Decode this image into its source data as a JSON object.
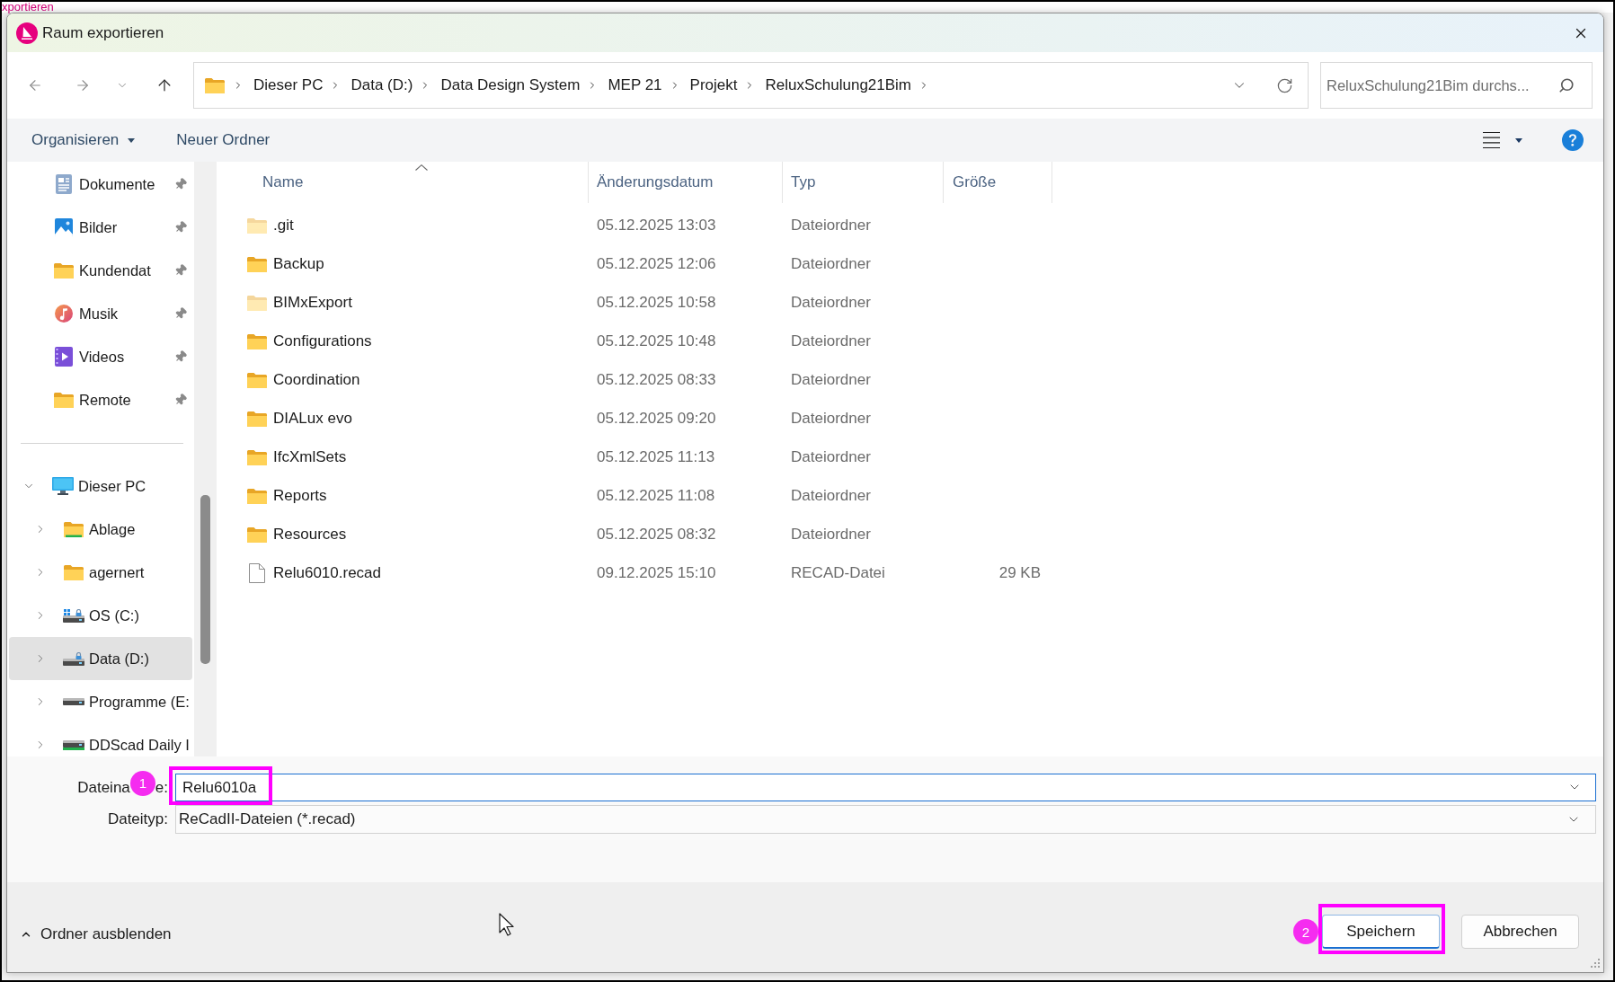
{
  "background": {
    "title_fragment": "xportieren"
  },
  "window": {
    "title": "Raum exportieren"
  },
  "address_bar": {
    "breadcrumbs": [
      "Dieser PC",
      "Data (D:)",
      "Data Design System",
      "MEP 21",
      "Projekt",
      "ReluxSchulung21Bim"
    ]
  },
  "search": {
    "placeholder": "ReluxSchulung21Bim durchs..."
  },
  "toolbar": {
    "items": [
      {
        "label": "Organisieren",
        "kind": "menu"
      },
      {
        "label": "Neuer Ordner",
        "kind": "button"
      }
    ]
  },
  "sidebar": {
    "quick_access": [
      {
        "label": "Dokumente",
        "kind": "documents",
        "pinned": true,
        "selected": false
      },
      {
        "label": "Bilder",
        "kind": "pictures",
        "pinned": true,
        "selected": false
      },
      {
        "label": "Kundendat",
        "kind": "folder",
        "pinned": true,
        "selected": false
      },
      {
        "label": "Musik",
        "kind": "music",
        "pinned": true,
        "selected": false
      },
      {
        "label": "Videos",
        "kind": "videos",
        "pinned": true,
        "selected": false
      },
      {
        "label": "Remote",
        "kind": "folder",
        "pinned": true,
        "selected": false
      }
    ],
    "tree": [
      {
        "label": "Dieser PC",
        "kind": "computer",
        "expanded": true,
        "selected": false,
        "children": [
          {
            "label": "Ablage",
            "kind": "sharedfolder",
            "expanded": false,
            "selected": false
          },
          {
            "label": "agernert",
            "kind": "folder",
            "expanded": false,
            "selected": false
          },
          {
            "label": "OS (C:)",
            "kind": "systemdrive",
            "expanded": false,
            "selected": false
          },
          {
            "label": "Data (D:)",
            "kind": "lockeddrive",
            "expanded": false,
            "selected": true
          },
          {
            "label": "Programme (E:",
            "kind": "drive",
            "expanded": false,
            "selected": false
          },
          {
            "label": "DDScad Daily I",
            "kind": "netdrive",
            "expanded": false,
            "selected": false
          }
        ]
      }
    ]
  },
  "file_list": {
    "columns": [
      {
        "label": "Name",
        "sorted": true
      },
      {
        "label": "Änderungsdatum",
        "sorted": false
      },
      {
        "label": "Typ",
        "sorted": false
      },
      {
        "label": "Größe",
        "sorted": false
      }
    ],
    "rows": [
      {
        "name": ".git",
        "modified": "05.12.2025 13:03",
        "type": "Dateiordner",
        "kind": "folder",
        "hidden": true,
        "selected": false
      },
      {
        "name": "Backup",
        "modified": "05.12.2025 12:06",
        "type": "Dateiordner",
        "kind": "folder",
        "hidden": false,
        "selected": false
      },
      {
        "name": "BIMxExport",
        "modified": "05.12.2025 10:58",
        "type": "Dateiordner",
        "kind": "folder",
        "hidden": true,
        "selected": false
      },
      {
        "name": "Configurations",
        "modified": "05.12.2025 10:48",
        "type": "Dateiordner",
        "kind": "folder",
        "hidden": false,
        "selected": false
      },
      {
        "name": "Coordination",
        "modified": "05.12.2025 08:33",
        "type": "Dateiordner",
        "kind": "folder",
        "hidden": false,
        "selected": false
      },
      {
        "name": "DIALux evo",
        "modified": "05.12.2025 09:20",
        "type": "Dateiordner",
        "kind": "folder",
        "hidden": false,
        "selected": false
      },
      {
        "name": "IfcXmlSets",
        "modified": "05.12.2025 11:13",
        "type": "Dateiordner",
        "kind": "folder",
        "hidden": false,
        "selected": false
      },
      {
        "name": "Reports",
        "modified": "05.12.2025 11:08",
        "type": "Dateiordner",
        "kind": "folder",
        "hidden": false,
        "selected": false
      },
      {
        "name": "Resources",
        "modified": "05.12.2025 08:32",
        "type": "Dateiordner",
        "kind": "folder",
        "hidden": false,
        "selected": false
      },
      {
        "name": "Relu6010.recad",
        "modified": "09.12.2025 15:10",
        "type": "RECAD-Datei",
        "size": "29 KB",
        "kind": "file",
        "hidden": false,
        "selected": false
      }
    ]
  },
  "form": {
    "filename": {
      "label_parts": [
        "Dateina",
        "e:"
      ],
      "value": "Relu6010a",
      "focused": true,
      "annotation": "1"
    },
    "filetype": {
      "label": "Dateityp:",
      "value": "ReCadII-Dateien (*.recad)"
    }
  },
  "footer": {
    "toggle": "Ordner ausblenden",
    "buttons": [
      {
        "label": "Speichern",
        "kind": "primary",
        "annotation": "2"
      },
      {
        "label": "Abbrechen",
        "kind": "secondary"
      }
    ]
  }
}
